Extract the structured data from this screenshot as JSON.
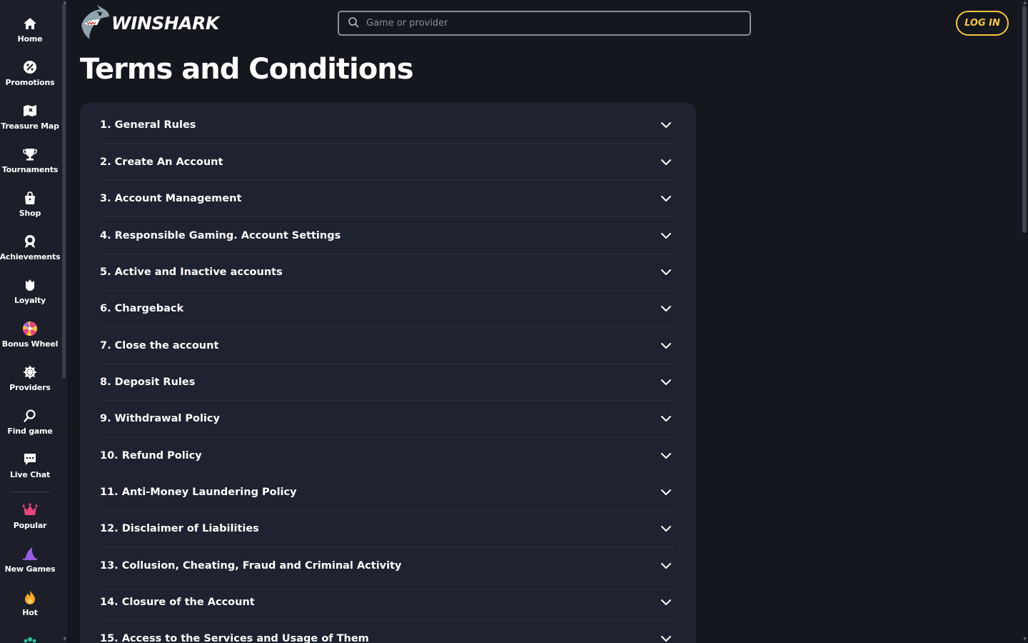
{
  "sidebar": {
    "items": [
      {
        "label": "Home",
        "icon": "home-icon"
      },
      {
        "label": "Promotions",
        "icon": "percent-icon"
      },
      {
        "label": "Treasure Map",
        "icon": "map-icon"
      },
      {
        "label": "Tournaments",
        "icon": "trophy-icon"
      },
      {
        "label": "Shop",
        "icon": "shopping-bag-icon"
      },
      {
        "label": "Achievements",
        "icon": "medal-icon"
      },
      {
        "label": "Loyalty",
        "icon": "crown-shield-icon"
      },
      {
        "label": "Bonus Wheel",
        "icon": "wheel-icon"
      },
      {
        "label": "Providers",
        "icon": "helm-icon"
      },
      {
        "label": "Find game",
        "icon": "search-icon"
      },
      {
        "label": "Live Chat",
        "icon": "chat-icon"
      }
    ],
    "categories": [
      {
        "label": "Popular",
        "icon": "crown-icon",
        "color": "#e8457c"
      },
      {
        "label": "New Games",
        "icon": "shark-fin-icon",
        "color": "#9b5de5"
      },
      {
        "label": "Hot",
        "icon": "fire-icon",
        "color": "#f5a623"
      }
    ]
  },
  "header": {
    "logo_text": "WINSHARK",
    "search_placeholder": "Game or provider",
    "login_label": "LOG IN",
    "accent_color": "#f5c542"
  },
  "page": {
    "title": "Terms and Conditions"
  },
  "terms": {
    "sections": [
      "1. General Rules",
      "2. Create An Account",
      "3. Account Management",
      "4. Responsible Gaming. Account Settings",
      "5. Active and Inactive accounts",
      "6. Chargeback",
      "7. Close the account",
      "8. Deposit Rules",
      "9. Withdrawal Policy",
      "10. Refund Policy",
      "11. Anti-Money Laundering Policy",
      "12. Disclaimer of Liabilities",
      "13. Collusion, Cheating, Fraud and Criminal Activity",
      "14. Closure of the Account",
      "15. Access to the Services and Usage of Them"
    ]
  }
}
